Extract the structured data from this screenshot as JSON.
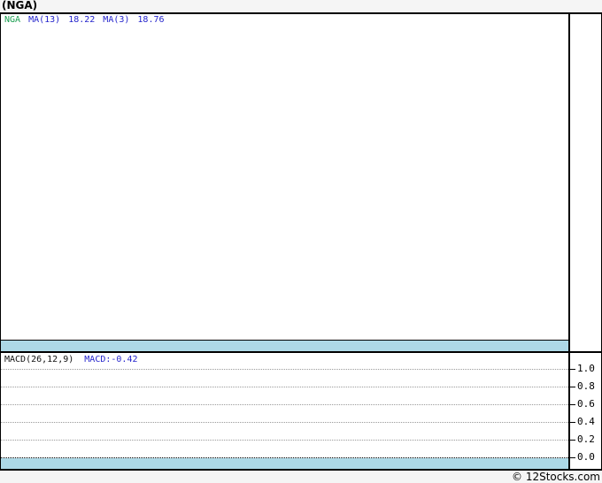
{
  "title": "(NGA)",
  "colors": {
    "page_bg": "#f5f5f5",
    "chart_bg": "#ffffff",
    "band": "#add8e6",
    "symbol_green": "#1a9e50",
    "indicator_blue": "#2424cc",
    "axis_black": "#000000",
    "gridline_gray": "#9a9a9a"
  },
  "main_panel": {
    "legend": {
      "symbol": "NGA",
      "ma13_label": "MA(13)",
      "ma13_value": "18.22",
      "ma3_label": "MA(3)",
      "ma3_value": "18.76"
    }
  },
  "macd_panel": {
    "legend_label": "MACD(26,12,9)",
    "legend_value": "MACD:-0.42",
    "axis_ticks": [
      "1.0",
      "0.8",
      "0.6",
      "0.4",
      "0.2",
      "0.0"
    ]
  },
  "footer": {
    "credit": "© 12Stocks.com"
  },
  "chart_data": [
    {
      "type": "line",
      "title": "(NGA) price panel",
      "series": [
        {
          "name": "NGA",
          "color": "#1a9e50",
          "values": []
        },
        {
          "name": "MA(13)",
          "color": "#2424cc",
          "last_value": 18.22,
          "values": []
        },
        {
          "name": "MA(3)",
          "color": "#2424cc",
          "last_value": 18.76,
          "values": []
        }
      ],
      "note": "panel is blank - no plotted points visible, right axis unlabeled",
      "grid": false,
      "legend_position": "top-left"
    },
    {
      "type": "line",
      "title": "MACD(26,12,9) panel",
      "series": [
        {
          "name": "MACD",
          "last_value": -0.42,
          "values": []
        }
      ],
      "ylabel": "",
      "yticks": [
        1.0,
        0.8,
        0.6,
        0.4,
        0.2,
        0.0
      ],
      "ylim": [
        0.0,
        1.0
      ],
      "grid": true,
      "note": "dotted horizontal gridlines every 0.2, black dotted zero line, no plotted points visible",
      "legend_position": "top-left"
    }
  ]
}
